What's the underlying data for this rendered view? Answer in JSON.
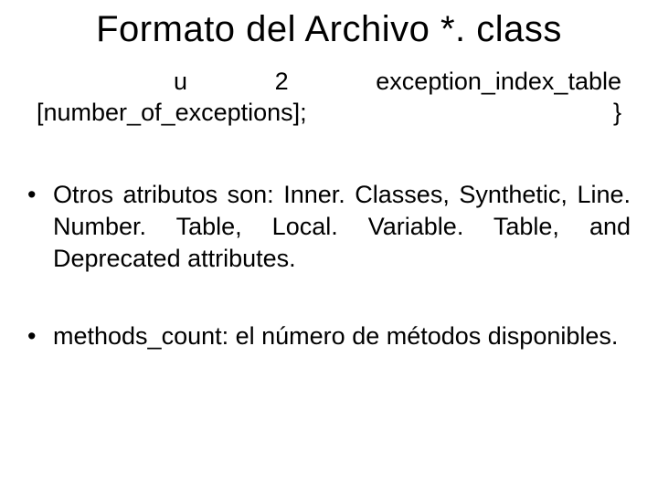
{
  "title": "Formato del Archivo *. class",
  "code": {
    "line1": "u 2 exception_index_table",
    "line2": "[number_of_exceptions]; }"
  },
  "bullets": [
    "Otros atributos son: Inner. Classes, Synthetic, Line. Number. Table, Local. Variable. Table, and Deprecated attributes.",
    "methods_count: el número de métodos disponibles."
  ]
}
